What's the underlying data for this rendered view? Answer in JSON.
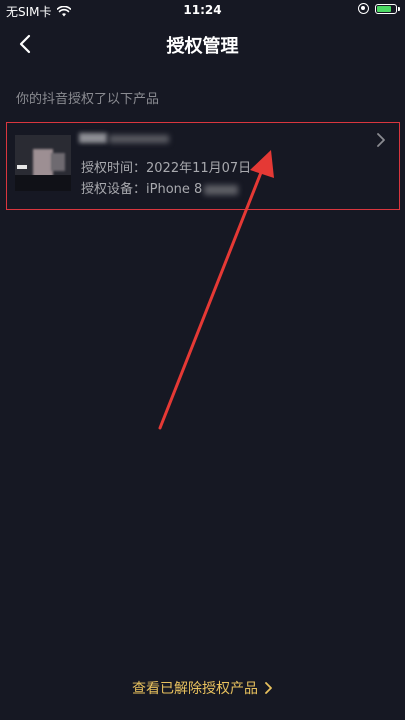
{
  "status_bar": {
    "carrier": "无SIM卡",
    "wifi_icon": "wifi-icon",
    "time": "11:24",
    "lock_icon": "orientation-lock-icon",
    "battery_icon": "battery-charging-icon",
    "battery_color": "#4cd964",
    "battery_level": 0.75
  },
  "nav": {
    "back_icon": "chevron-left-icon",
    "title": "授权管理"
  },
  "section": {
    "label": "你的抖音授权了以下产品"
  },
  "product": {
    "name": "",
    "time_label": "授权时间：",
    "time_value": "2022年11月07日",
    "device_label": "授权设备：",
    "device_value": "iPhone 8",
    "chevron_icon": "chevron-right-icon"
  },
  "footer": {
    "link_label": "查看已解除授权产品",
    "link_icon": "chevron-right-icon"
  },
  "colors": {
    "background": "#161823",
    "highlight": "#d9363e",
    "link": "#e8c15e",
    "secondary_text": "#8a8b91"
  }
}
